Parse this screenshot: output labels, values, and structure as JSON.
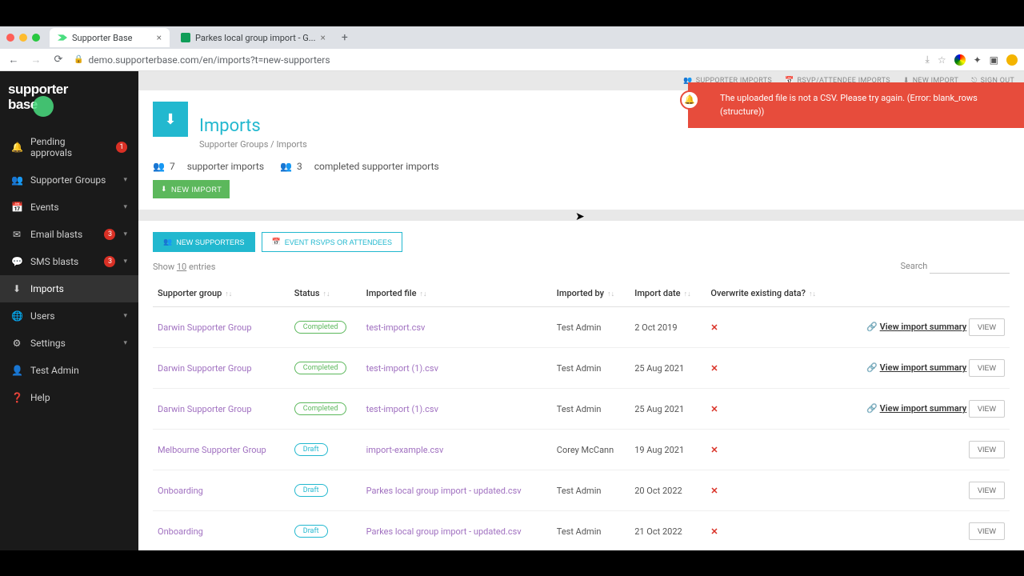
{
  "browser": {
    "tabs": [
      {
        "title": "Supporter Base",
        "active": true
      },
      {
        "title": "Parkes local group import - G...",
        "active": false
      }
    ],
    "url": "demo.supporterbase.com/en/imports?t=new-supporters"
  },
  "sidebar": {
    "logo": "supporter base",
    "items": [
      {
        "icon": "bell",
        "label": "Pending approvals",
        "badge": "1",
        "caret": false
      },
      {
        "icon": "group",
        "label": "Supporter Groups",
        "caret": true
      },
      {
        "icon": "calendar",
        "label": "Events",
        "caret": true
      },
      {
        "icon": "mail",
        "label": "Email blasts",
        "badge": "3",
        "caret": true
      },
      {
        "icon": "sms",
        "label": "SMS blasts",
        "badge": "3",
        "caret": true
      },
      {
        "icon": "download",
        "label": "Imports",
        "active": true
      },
      {
        "icon": "globe",
        "label": "Users",
        "caret": true
      },
      {
        "icon": "gear",
        "label": "Settings",
        "caret": true
      },
      {
        "icon": "user",
        "label": "Test Admin"
      },
      {
        "icon": "help",
        "label": "Help"
      }
    ]
  },
  "topnav": {
    "items": [
      {
        "label": "SUPPORTER IMPORTS"
      },
      {
        "label": "RSVP/ATTENDEE IMPORTS"
      },
      {
        "label": "NEW IMPORT"
      },
      {
        "label": "SIGN OUT"
      }
    ]
  },
  "header": {
    "title": "Imports",
    "breadcrumb_root": "Supporter Groups",
    "breadcrumb_sep": "/",
    "breadcrumb_current": "Imports",
    "stat1_count": "7",
    "stat1_label": "supporter imports",
    "stat2_count": "3",
    "stat2_label": "completed supporter imports",
    "new_import_btn": "NEW IMPORT"
  },
  "table_tabs": {
    "new_supporters": "NEW SUPPORTERS",
    "event_rsvps": "EVENT RSVPS OR ATTENDEES"
  },
  "table_controls": {
    "show_prefix": "Show",
    "show_count": "10",
    "show_suffix": "entries",
    "search_label": "Search"
  },
  "columns": {
    "group": "Supporter group",
    "status": "Status",
    "file": "Imported file",
    "by": "Imported by",
    "date": "Import date",
    "overwrite": "Overwrite existing data?"
  },
  "rows": [
    {
      "group": "Darwin Supporter Group",
      "status": "Completed",
      "status_class": "completed",
      "file": "test-import.csv",
      "by": "Test Admin",
      "date": "2 Oct 2019",
      "overwrite": "✕",
      "summary": "View import summary",
      "view": "VIEW"
    },
    {
      "group": "Darwin Supporter Group",
      "status": "Completed",
      "status_class": "completed",
      "file": "test-import (1).csv",
      "by": "Test Admin",
      "date": "25 Aug 2021",
      "overwrite": "✕",
      "summary": "View import summary",
      "view": "VIEW"
    },
    {
      "group": "Darwin Supporter Group",
      "status": "Completed",
      "status_class": "completed",
      "file": "test-import (1).csv",
      "by": "Test Admin",
      "date": "25 Aug 2021",
      "overwrite": "✕",
      "summary": "View import summary",
      "view": "VIEW"
    },
    {
      "group": "Melbourne Supporter Group",
      "status": "Draft",
      "status_class": "draft",
      "file": "import-example.csv",
      "by": "Corey McCann",
      "date": "19 Aug 2021",
      "overwrite": "✕",
      "summary": "",
      "view": "VIEW"
    },
    {
      "group": "Onboarding",
      "status": "Draft",
      "status_class": "draft",
      "file": "Parkes local group import - updated.csv",
      "by": "Test Admin",
      "date": "20 Oct 2022",
      "overwrite": "✕",
      "summary": "",
      "view": "VIEW"
    },
    {
      "group": "Onboarding",
      "status": "Draft",
      "status_class": "draft",
      "file": "Parkes local group import - updated.csv",
      "by": "Test Admin",
      "date": "21 Oct 2022",
      "overwrite": "✕",
      "summary": "",
      "view": "VIEW"
    }
  ],
  "toast": {
    "message": "The uploaded file is not a CSV. Please try again. (Error: blank_rows (structure))"
  }
}
